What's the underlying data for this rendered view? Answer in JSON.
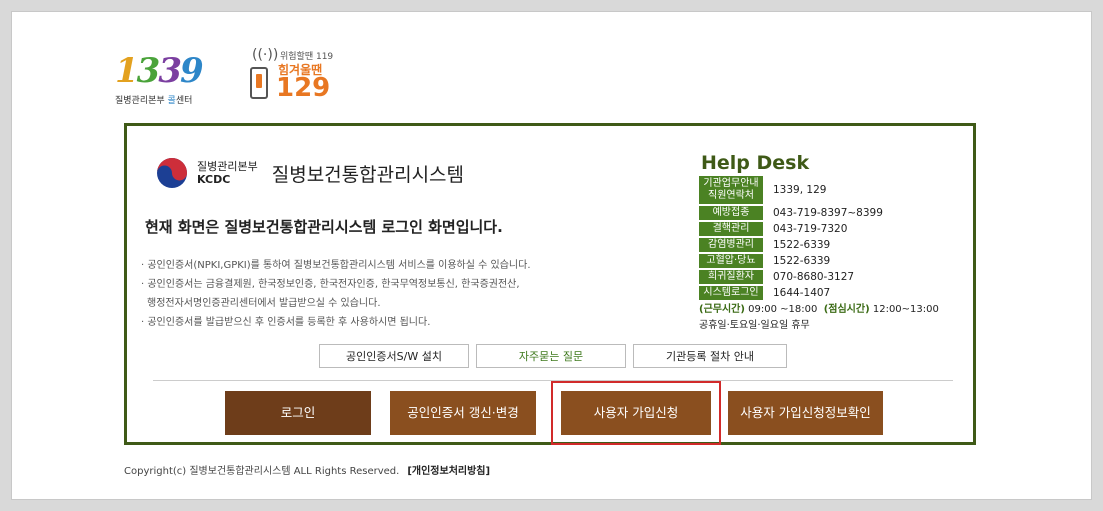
{
  "logos": {
    "hotline_1339": {
      "digits": [
        "1",
        "3",
        "3",
        "9"
      ],
      "sub_prefix": "질병관리본부 ",
      "sub_highlight": "콜",
      "sub_suffix": "센터"
    },
    "hotline_129": {
      "top": "위험할땐 119",
      "middle": "힘겨울땐",
      "number": "129"
    }
  },
  "brand": {
    "org_ko": "질병관리본부",
    "org_en": "KCDC",
    "system_title": "질병보건통합관리시스템"
  },
  "headline": "현재 화면은 질병보건통합관리시스템 로그인 화면입니다.",
  "notes": [
    "· 공인인증서(NPKI,GPKI)를 통하여 질병보건통합관리시스템 서비스를 이용하실 수 있습니다.",
    "· 공인인증서는 금융결제원, 한국정보인증, 한국전자인증, 한국무역정보통신, 한국증권전산,",
    "  행정전자서명인증관리센터에서 발급받으실 수 있습니다.",
    "· 공인인증서를 발급받으신 후 인증서를 등록한 후 사용하시면 됩니다."
  ],
  "helpdesk": {
    "title": "Help Desk",
    "rows": [
      {
        "label": "기관업무안내\n직원연락처",
        "value": "1339, 129"
      },
      {
        "label": "예방접종",
        "value": "043-719-8397~8399"
      },
      {
        "label": "결핵관리",
        "value": "043-719-7320"
      },
      {
        "label": "감염병관리",
        "value": "1522-6339"
      },
      {
        "label": "고혈압·당뇨",
        "value": "1522-6339"
      },
      {
        "label": "희귀질환자",
        "value": "070-8680-3127"
      },
      {
        "label": "시스템로그인",
        "value": "1644-1407"
      }
    ],
    "hours_label": "(근무시간)",
    "hours_value": "09:00 ~18:00",
    "lunch_label": "(점심시간)",
    "lunch_value": "12:00~13:00",
    "holiday": "공휴일·토요일·일요일 휴무"
  },
  "links": {
    "install": "공인인증서S/W 설치",
    "faq": "자주묻는 질문",
    "register_guide": "기관등록 절차 안내"
  },
  "actions": {
    "login": "로그인",
    "renew": "공인인증서 갱신·변경",
    "signup": "사용자 가입신청",
    "signup_check": "사용자 가입신청정보확인"
  },
  "footer": {
    "copyright": "Copyright(c) 질병보건통합관리시스템 ALL Rights Reserved.",
    "privacy": "[개인정보처리방침]"
  },
  "colors": {
    "frame_green": "#3f5a17",
    "badge_green": "#4b8223",
    "button_brown": "#8a4f1f",
    "highlight_red": "#d12a2a"
  }
}
